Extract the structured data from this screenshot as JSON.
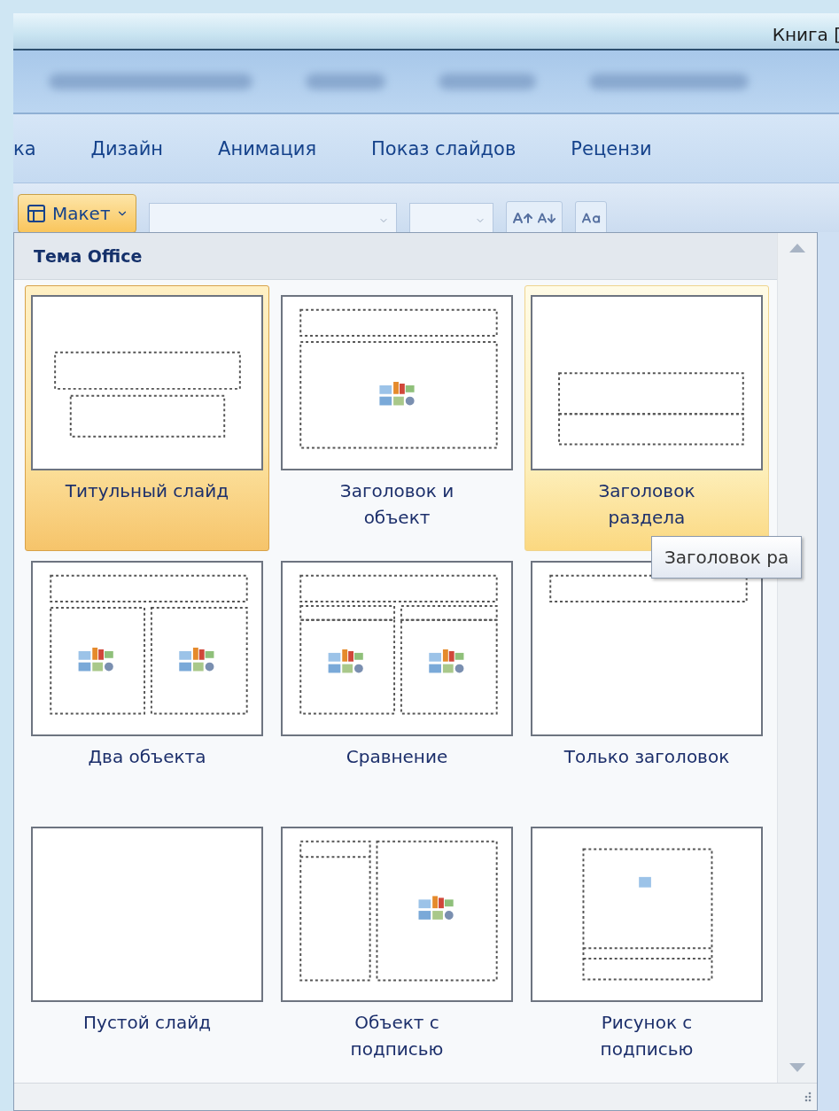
{
  "window": {
    "title": "Книга ["
  },
  "tabs": [
    {
      "label": "ка"
    },
    {
      "label": "Дизайн"
    },
    {
      "label": "Анимация"
    },
    {
      "label": "Показ слайдов"
    },
    {
      "label": "Рецензи"
    }
  ],
  "ribbon": {
    "layout_button": {
      "label": "Макет",
      "pressed": true
    }
  },
  "gallery": {
    "heading": "Тема Office",
    "layouts": [
      {
        "kind": "title",
        "label": "Титульный слайд",
        "selected": true,
        "hovered": false
      },
      {
        "kind": "title-content",
        "label": "Заголовок и\nобъект",
        "selected": false,
        "hovered": false
      },
      {
        "kind": "section",
        "label": "Заголовок\nраздела",
        "selected": false,
        "hovered": true
      },
      {
        "kind": "two-content",
        "label": "Два объекта",
        "selected": false,
        "hovered": false
      },
      {
        "kind": "comparison",
        "label": "Сравнение",
        "selected": false,
        "hovered": false
      },
      {
        "kind": "title-only",
        "label": "Только заголовок",
        "selected": false,
        "hovered": false
      },
      {
        "kind": "blank",
        "label": "Пустой слайд",
        "selected": false,
        "hovered": false
      },
      {
        "kind": "content-caption",
        "label": "Объект с\nподписью",
        "selected": false,
        "hovered": false
      },
      {
        "kind": "picture-caption",
        "label": "Рисунок с\nподписью",
        "selected": false,
        "hovered": false
      }
    ]
  },
  "tooltip": "Заголовок ра"
}
